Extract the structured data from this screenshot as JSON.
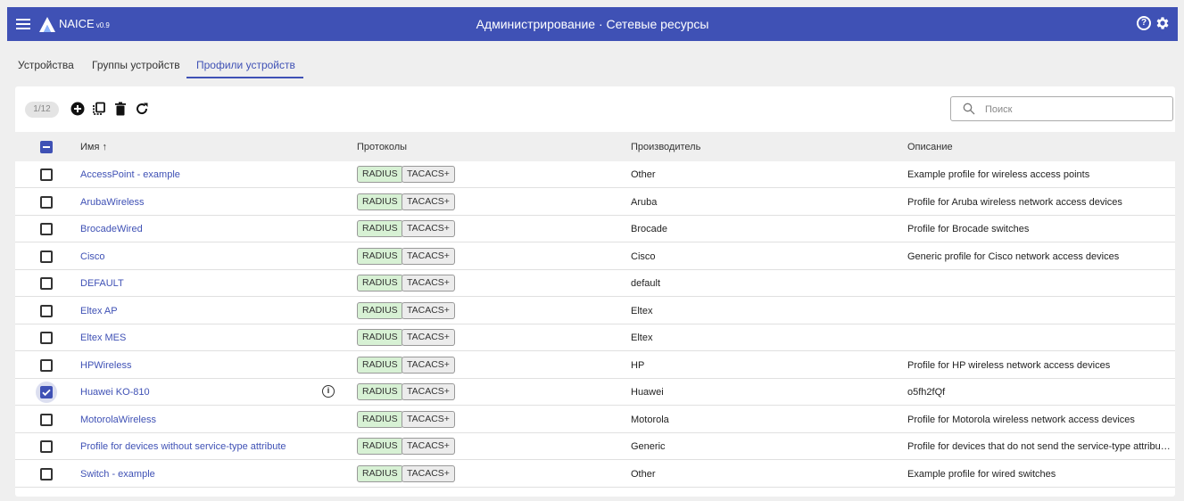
{
  "app": {
    "name": "NAICE",
    "version": "v0.9",
    "title": "Администрирование · Сетевые ресурсы",
    "help_glyph": "?",
    "accent": "#3f51b5"
  },
  "tabs": [
    {
      "label": "Устройства",
      "active": false
    },
    {
      "label": "Группы устройств",
      "active": false
    },
    {
      "label": "Профили устройств",
      "active": true
    }
  ],
  "toolbar": {
    "selection_counter": "1/12",
    "icons": [
      "add-icon",
      "copy-icon",
      "delete-icon",
      "refresh-icon"
    ]
  },
  "search": {
    "placeholder": "Поиск",
    "value": ""
  },
  "table": {
    "columns": [
      "Имя ↑",
      "Протоколы",
      "Производитель",
      "Описание"
    ],
    "protocol_labels": [
      "RADIUS",
      "TACACS+"
    ],
    "rows": [
      {
        "name": "AccessPoint - example",
        "vendor": "Other",
        "description": "Example profile for wireless access points",
        "checked": false
      },
      {
        "name": "ArubaWireless",
        "vendor": "Aruba",
        "description": "Profile for Aruba wireless network access devices",
        "checked": false
      },
      {
        "name": "BrocadeWired",
        "vendor": "Brocade",
        "description": "Profile for Brocade switches",
        "checked": false
      },
      {
        "name": "Cisco",
        "vendor": "Cisco",
        "description": "Generic profile for Cisco network access devices",
        "checked": false
      },
      {
        "name": "DEFAULT",
        "vendor": "default",
        "description": "",
        "checked": false
      },
      {
        "name": "Eltex AP",
        "vendor": "Eltex",
        "description": "",
        "checked": false
      },
      {
        "name": "Eltex MES",
        "vendor": "Eltex",
        "description": "",
        "checked": false
      },
      {
        "name": "HPWireless",
        "vendor": "HP",
        "description": "Profile for HP wireless network access devices",
        "checked": false
      },
      {
        "name": "Huawei KO-810",
        "vendor": "Huawei",
        "description": "o5fh2fQf",
        "checked": true,
        "info_icon": "i"
      },
      {
        "name": "MotorolaWireless",
        "vendor": "Motorola",
        "description": "Profile for Motorola wireless network access devices",
        "checked": false
      },
      {
        "name": "Profile for devices without service-type attribute",
        "vendor": "Generic",
        "description": "Profile for devices that do not send the service-type attribut...",
        "checked": false
      },
      {
        "name": "Switch - example",
        "vendor": "Other",
        "description": "Example profile for wired switches",
        "checked": false
      }
    ]
  }
}
